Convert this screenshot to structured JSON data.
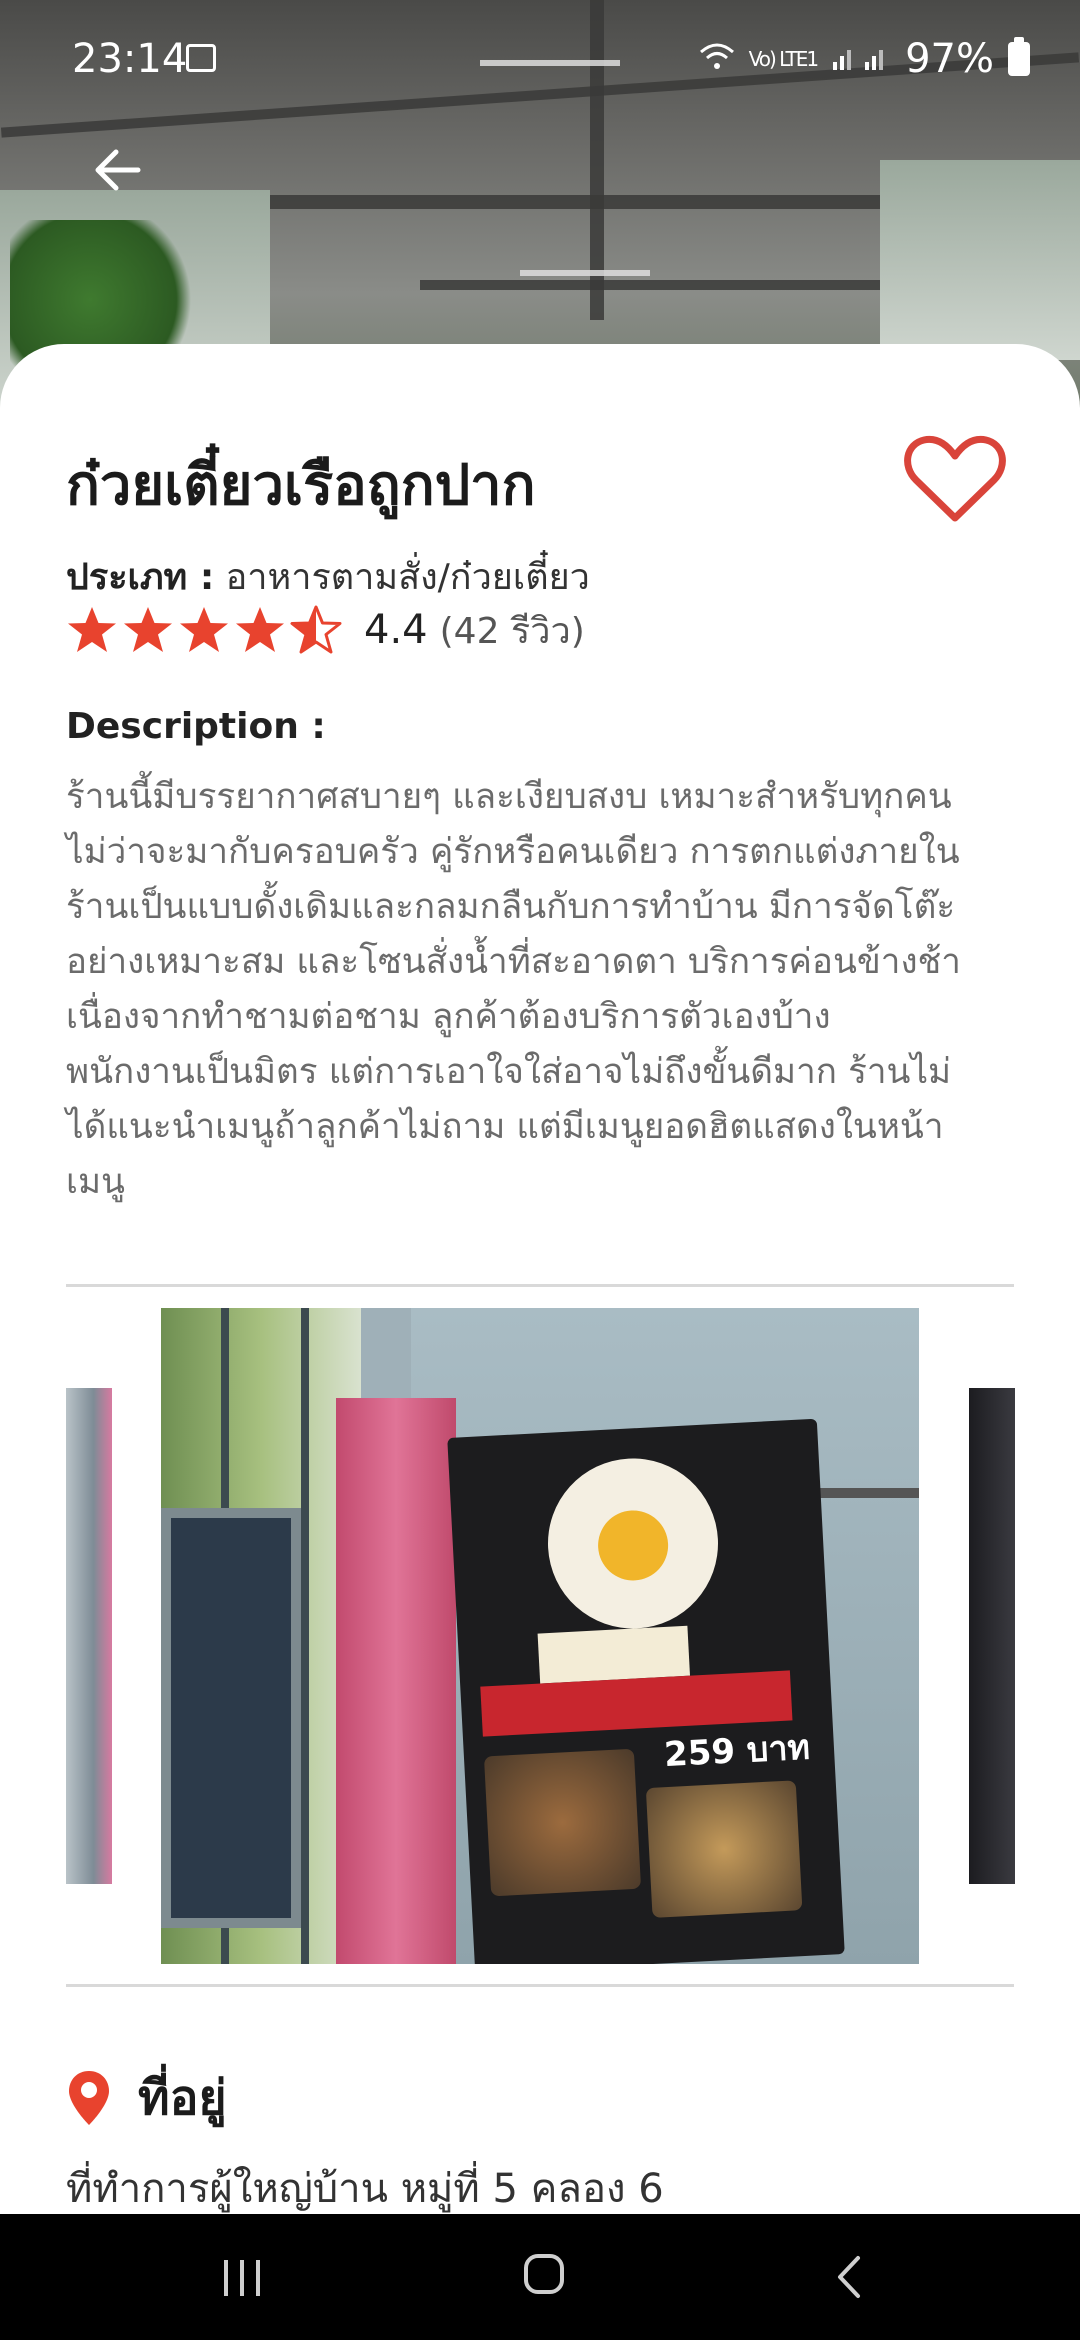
{
  "status_bar": {
    "time": "23:14",
    "network": "Vo) LTE1",
    "battery": "97%"
  },
  "restaurant": {
    "name": "ก๋วยเตี๋ยวเรือถูกปาก",
    "category_label": "ประเภท :",
    "category_value": "อาหารตามสั่ง/ก๋วยเตี๋ยว",
    "rating": 4.4,
    "rating_text": "4.4",
    "review_count_text": "(42 รีวิว)",
    "favorite": false
  },
  "description": {
    "label": "Description :",
    "lines": [
      "ร้านนี้มีบรรยากาศสบายๆ และเงียบสงบ เหมาะสำหรับทุกคน",
      "ไม่ว่าจะมากับครอบครัว คู่รักหรือคนเดียว การตกแต่งภายใน",
      "ร้านเป็นแบบดั้งเดิมและกลมกลืนกับการทำบ้าน มีการจัดโต๊ะ",
      "อย่างเหมาะสม และโซนสั่งน้ำที่สะอาดตา บริการค่อนข้างช้า",
      "เนื่องจากทำชามต่อชาม ลูกค้าต้องบริการตัวเองบ้าง",
      "พนักงานเป็นมิตร แต่การเอาใจใส่อาจไม่ถึงขั้นดีมาก ร้านไม่",
      "ได้แนะนำเมนูถ้าลูกค้าไม่ถาม แต่มีเมนูยอดฮิตแสดงในหน้า",
      "เมนู"
    ]
  },
  "gallery": {
    "sign_price": "259 บาท"
  },
  "address": {
    "title": "ที่อยู่",
    "text": "ที่ทำการผู้ใหญ่บ้าน หมู่ที่ 5 คลอง 6"
  },
  "colors": {
    "accent": "#e8432e",
    "heart": "#d9443a"
  },
  "icons": [
    "back-arrow-icon",
    "heart-icon",
    "star-icon",
    "half-star-icon",
    "location-pin-icon"
  ]
}
